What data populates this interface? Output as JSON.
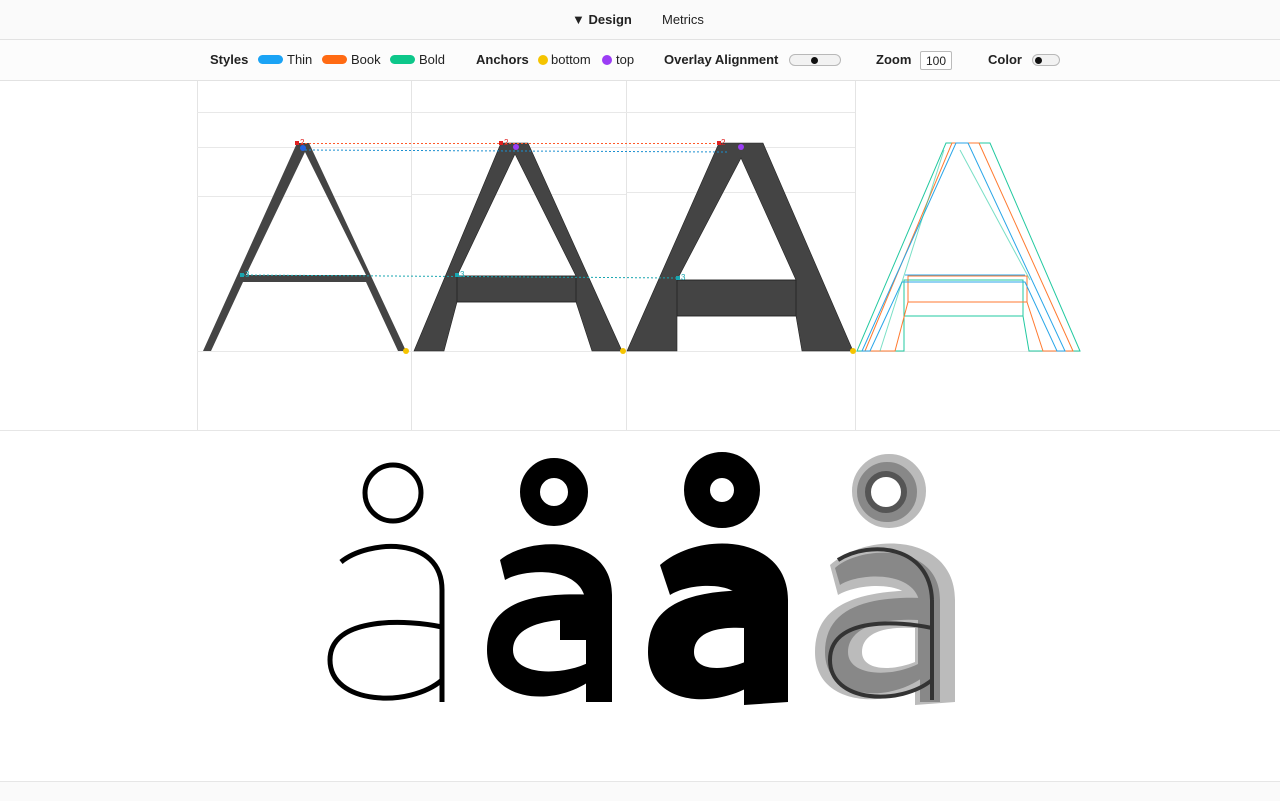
{
  "topbar": {
    "design_tab": "▼ Design",
    "metrics_tab": "Metrics"
  },
  "toolbar": {
    "styles_label": "Styles",
    "styles": [
      {
        "name": "Thin",
        "color": "#1aa3f5"
      },
      {
        "name": "Book",
        "color": "#ff6a13"
      },
      {
        "name": "Bold",
        "color": "#0dc78a"
      }
    ],
    "anchors_label": "Anchors",
    "anchors": [
      {
        "name": "bottom",
        "color": "#f5c400"
      },
      {
        "name": "top",
        "color": "#9b3df5"
      }
    ],
    "overlay_label": "Overlay Alignment",
    "overlay_on": true,
    "zoom_label": "Zoom",
    "zoom_value": "100",
    "color_label": "Color",
    "color_on": false
  },
  "glyph_editor": {
    "point_labels": {
      "top_point": "2",
      "crossbar_point": "3"
    },
    "overlay_colors": {
      "thin": "#2aa6e8",
      "book": "#ff7a30",
      "bold": "#22c9a0"
    }
  },
  "preview": {
    "glyph": "å"
  }
}
